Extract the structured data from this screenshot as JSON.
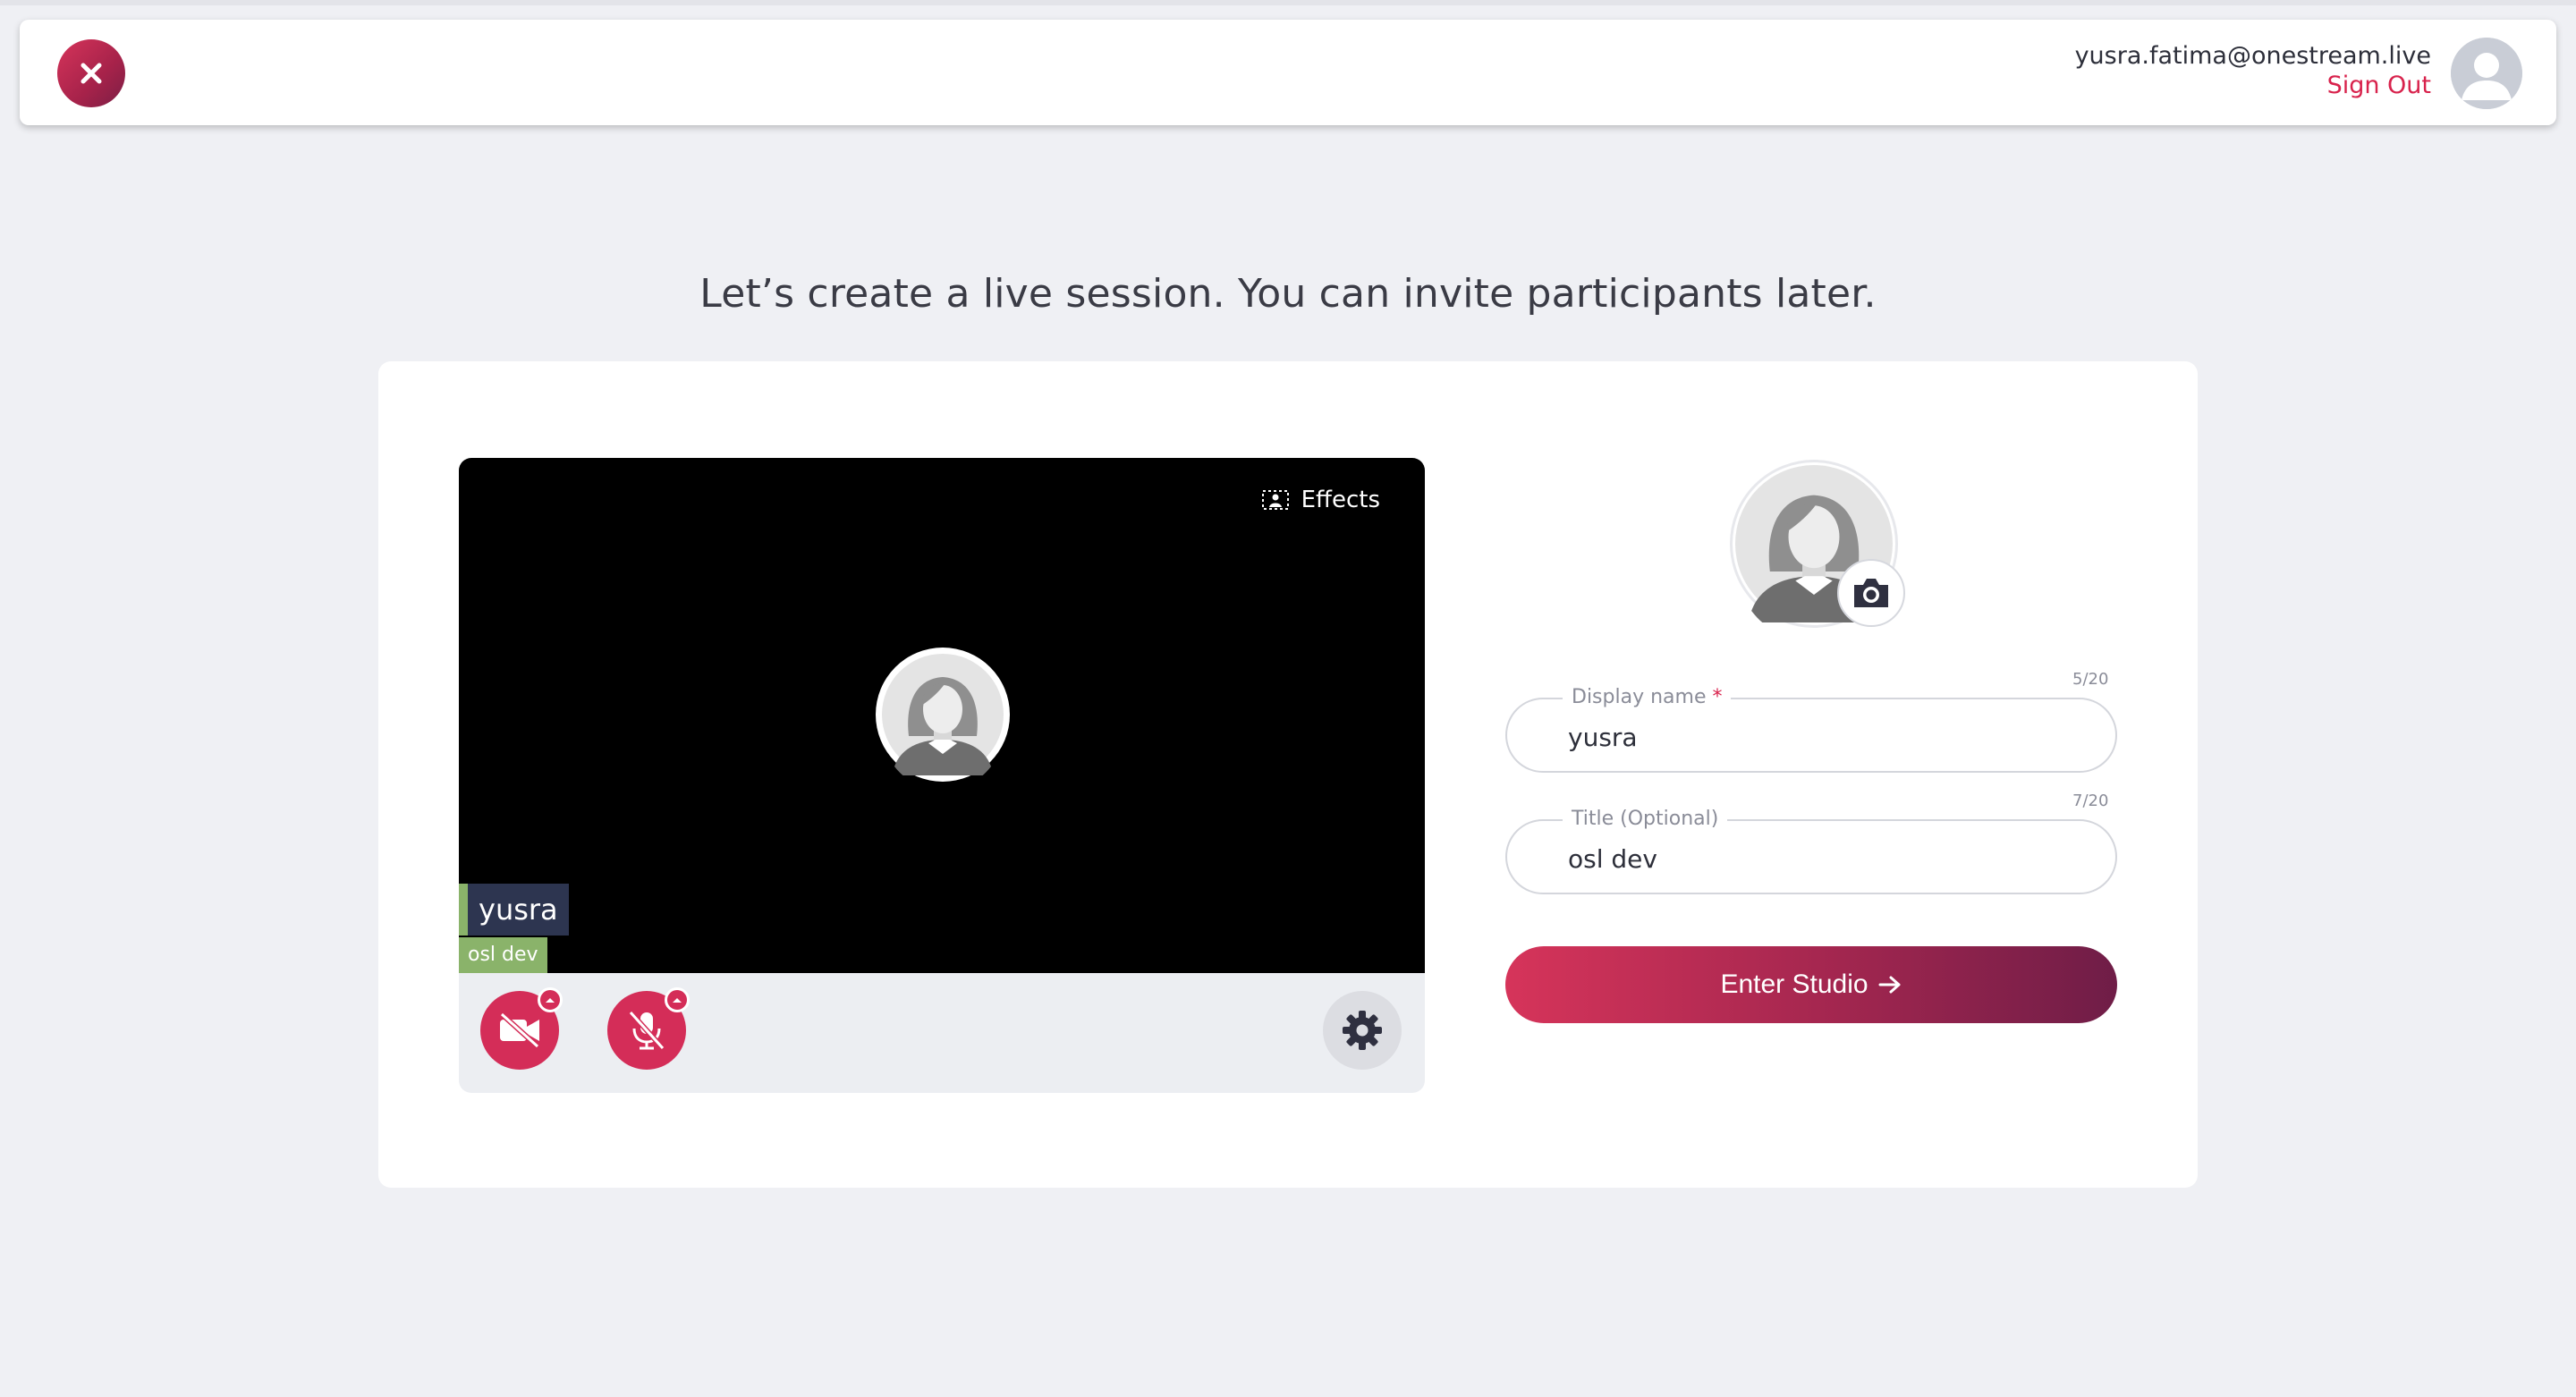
{
  "header": {
    "user_email": "yusra.fatima@onestream.live",
    "sign_out_label": "Sign Out"
  },
  "headline": "Let’s create a live session. You can invite participants later.",
  "preview": {
    "effects_label": "Effects",
    "name_tag": "yusra",
    "title_tag": "osl dev"
  },
  "form": {
    "display_name": {
      "label": "Display name",
      "required_mark": "*",
      "value": "yusra",
      "counter": "5/20"
    },
    "title": {
      "label": "Title (Optional)",
      "value": "osl dev",
      "counter": "7/20"
    },
    "enter_button_label": "Enter Studio"
  },
  "colors": {
    "accent": "#d42d58",
    "accent_dark": "#6f1d47",
    "sign_out": "#d8224c",
    "name_tag_bg": "#2d3550",
    "title_tag_bg": "#8ab36a",
    "page_bg": "#eff0f4"
  },
  "icons": {
    "close": "close-icon",
    "effects": "effects-icon",
    "camera_off": "video-off-icon",
    "mic_off": "mic-off-icon",
    "settings": "gear-icon",
    "upload_photo": "camera-icon",
    "arrow": "arrow-right-icon"
  }
}
